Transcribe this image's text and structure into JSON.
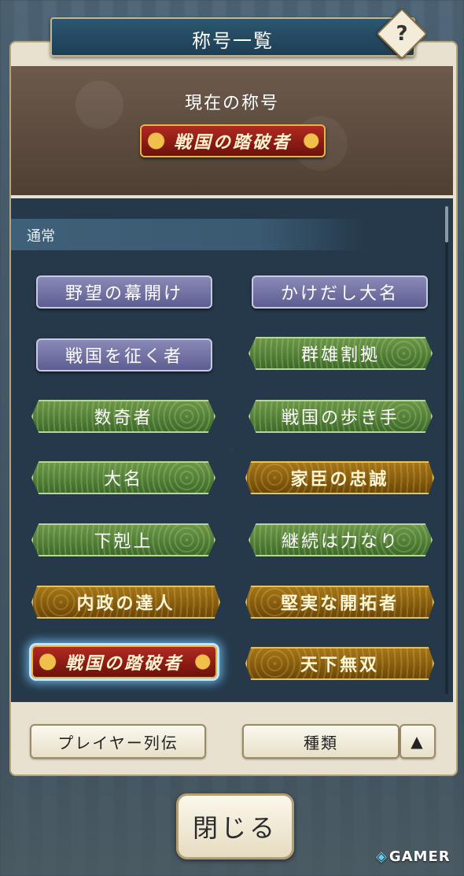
{
  "header": {
    "title": "称号一覧",
    "help_label": "?"
  },
  "current": {
    "label": "現在の称号",
    "title": "戦国の踏破者",
    "style": "red"
  },
  "section": {
    "label": "通常"
  },
  "titles": [
    {
      "label": "野望の幕開け",
      "style": "purple",
      "selected": false
    },
    {
      "label": "かけだし大名",
      "style": "purple",
      "selected": false
    },
    {
      "label": "戦国を征く者",
      "style": "purple",
      "selected": false
    },
    {
      "label": "群雄割拠",
      "style": "green",
      "selected": false
    },
    {
      "label": "数奇者",
      "style": "green",
      "selected": false
    },
    {
      "label": "戦国の歩き手",
      "style": "green",
      "selected": false
    },
    {
      "label": "大名",
      "style": "green",
      "selected": false
    },
    {
      "label": "家臣の忠誠",
      "style": "gold",
      "selected": false
    },
    {
      "label": "下剋上",
      "style": "green",
      "selected": false
    },
    {
      "label": "継続は力なり",
      "style": "green",
      "selected": false
    },
    {
      "label": "内政の達人",
      "style": "gold",
      "selected": false
    },
    {
      "label": "堅実な開拓者",
      "style": "gold",
      "selected": false
    },
    {
      "label": "戦国の踏破者",
      "style": "red",
      "selected": true
    },
    {
      "label": "天下無双",
      "style": "gold",
      "selected": false
    }
  ],
  "footer": {
    "player_button": "プレイヤー列伝",
    "sort_button": "種類",
    "sort_toggle": "▲",
    "close_button": "閉じる"
  },
  "watermark": {
    "icon": "gamer-logo-icon",
    "text": "GAMER"
  },
  "colors": {
    "header_bg": "#1d3f55",
    "list_bg": "#25394a",
    "panel_frame": "#e8e1cf"
  }
}
